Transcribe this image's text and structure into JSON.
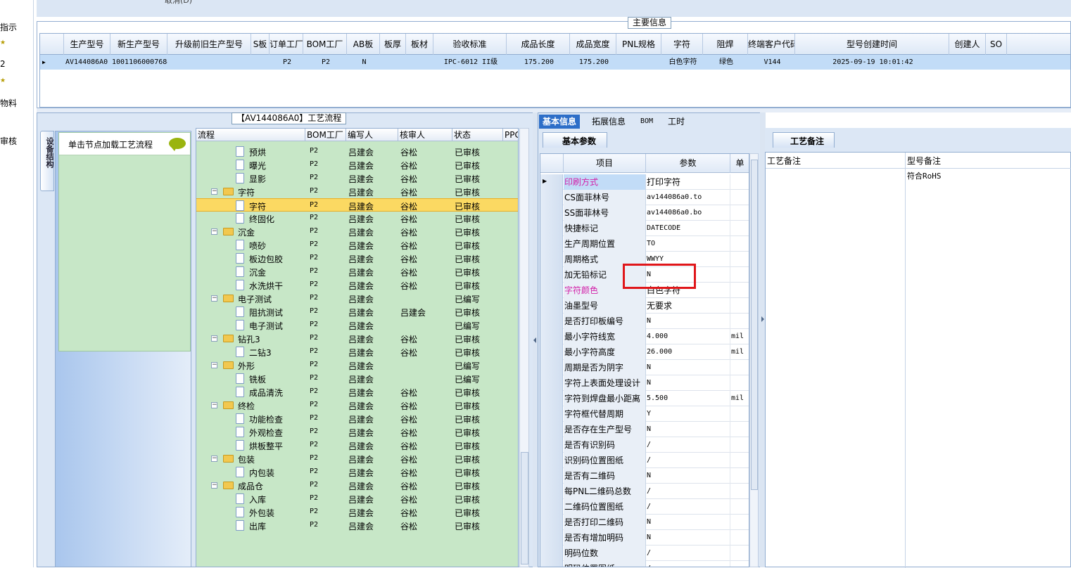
{
  "left_nav": {
    "items": [
      "指示",
      "2",
      "物料",
      "审核"
    ]
  },
  "top_strip": {
    "text": "取消(D)"
  },
  "main_info": {
    "legend": "主要信息",
    "columns": [
      "生产型号",
      "新生产型号",
      "升级前旧生产型号",
      "S板",
      "订单工厂",
      "BOM工厂",
      "AB板",
      "板厚",
      "板材",
      "验收标准",
      "成品长度",
      "成品宽度",
      "PNL规格",
      "字符",
      "阻焊",
      "终端客户代码",
      "型号创建时间",
      "创建人",
      "SO"
    ],
    "row": [
      "AV144086A0",
      "10011060007684",
      "",
      "",
      "P2",
      "P2",
      "N",
      "",
      "",
      "IPC-6012 II级",
      "175.200",
      "175.200",
      "",
      "白色字符",
      "绿色",
      "V144",
      "2025-09-19 10:01:42",
      "",
      ""
    ]
  },
  "process": {
    "legend": "【AV144086A0】工艺流程",
    "vertical_tab": "设备结构",
    "load_hint": "单击节点加载工艺流程",
    "columns": [
      "流程",
      "BOM工厂",
      "编写人",
      "核审人",
      "状态",
      "PPC"
    ],
    "rows": [
      {
        "type": "leaf",
        "name": "预烘",
        "bom": "P2",
        "writer": "吕建会",
        "reviewer": "谷松",
        "status": "已审核"
      },
      {
        "type": "leaf",
        "name": "曝光",
        "bom": "P2",
        "writer": "吕建会",
        "reviewer": "谷松",
        "status": "已审核"
      },
      {
        "type": "leaf",
        "name": "显影",
        "bom": "P2",
        "writer": "吕建会",
        "reviewer": "谷松",
        "status": "已审核"
      },
      {
        "type": "folder",
        "name": "字符",
        "bom": "P2",
        "writer": "吕建会",
        "reviewer": "谷松",
        "status": "已审核"
      },
      {
        "type": "leaf",
        "name": "字符",
        "bom": "P2",
        "writer": "吕建会",
        "reviewer": "谷松",
        "status": "已审核",
        "selected": true
      },
      {
        "type": "leaf",
        "name": "终固化",
        "bom": "P2",
        "writer": "吕建会",
        "reviewer": "谷松",
        "status": "已审核"
      },
      {
        "type": "folder",
        "name": "沉金",
        "bom": "P2",
        "writer": "吕建会",
        "reviewer": "谷松",
        "status": "已审核"
      },
      {
        "type": "leaf",
        "name": "喷砂",
        "bom": "P2",
        "writer": "吕建会",
        "reviewer": "谷松",
        "status": "已审核"
      },
      {
        "type": "leaf",
        "name": "板边包胶",
        "bom": "P2",
        "writer": "吕建会",
        "reviewer": "谷松",
        "status": "已审核"
      },
      {
        "type": "leaf",
        "name": "沉金",
        "bom": "P2",
        "writer": "吕建会",
        "reviewer": "谷松",
        "status": "已审核"
      },
      {
        "type": "leaf",
        "name": "水洗烘干",
        "bom": "P2",
        "writer": "吕建会",
        "reviewer": "谷松",
        "status": "已审核"
      },
      {
        "type": "folder",
        "name": "电子测试",
        "bom": "P2",
        "writer": "吕建会",
        "reviewer": "",
        "status": "已编写"
      },
      {
        "type": "leaf",
        "name": "阻抗测试",
        "bom": "P2",
        "writer": "吕建会",
        "reviewer": "吕建会",
        "status": "已审核"
      },
      {
        "type": "leaf",
        "name": "电子测试",
        "bom": "P2",
        "writer": "吕建会",
        "reviewer": "",
        "status": "已编写"
      },
      {
        "type": "folder",
        "name": "钻孔3",
        "bom": "P2",
        "writer": "吕建会",
        "reviewer": "谷松",
        "status": "已审核"
      },
      {
        "type": "leaf",
        "name": "二钻3",
        "bom": "P2",
        "writer": "吕建会",
        "reviewer": "谷松",
        "status": "已审核"
      },
      {
        "type": "folder",
        "name": "外形",
        "bom": "P2",
        "writer": "吕建会",
        "reviewer": "",
        "status": "已编写"
      },
      {
        "type": "leaf",
        "name": "铣板",
        "bom": "P2",
        "writer": "吕建会",
        "reviewer": "",
        "status": "已编写"
      },
      {
        "type": "leaf",
        "name": "成品清洗",
        "bom": "P2",
        "writer": "吕建会",
        "reviewer": "谷松",
        "status": "已审核"
      },
      {
        "type": "folder",
        "name": "终检",
        "bom": "P2",
        "writer": "吕建会",
        "reviewer": "谷松",
        "status": "已审核"
      },
      {
        "type": "leaf",
        "name": "功能检查",
        "bom": "P2",
        "writer": "吕建会",
        "reviewer": "谷松",
        "status": "已审核"
      },
      {
        "type": "leaf",
        "name": "外观检查",
        "bom": "P2",
        "writer": "吕建会",
        "reviewer": "谷松",
        "status": "已审核"
      },
      {
        "type": "leaf",
        "name": "烘板整平",
        "bom": "P2",
        "writer": "吕建会",
        "reviewer": "谷松",
        "status": "已审核"
      },
      {
        "type": "folder",
        "name": "包装",
        "bom": "P2",
        "writer": "吕建会",
        "reviewer": "谷松",
        "status": "已审核"
      },
      {
        "type": "leaf",
        "name": "内包装",
        "bom": "P2",
        "writer": "吕建会",
        "reviewer": "谷松",
        "status": "已审核"
      },
      {
        "type": "folder",
        "name": "成品仓",
        "bom": "P2",
        "writer": "吕建会",
        "reviewer": "谷松",
        "status": "已审核"
      },
      {
        "type": "leaf",
        "name": "入库",
        "bom": "P2",
        "writer": "吕建会",
        "reviewer": "谷松",
        "status": "已审核"
      },
      {
        "type": "leaf",
        "name": "外包装",
        "bom": "P2",
        "writer": "吕建会",
        "reviewer": "谷松",
        "status": "已审核"
      },
      {
        "type": "leaf",
        "name": "出库",
        "bom": "P2",
        "writer": "吕建会",
        "reviewer": "谷松",
        "status": "已审核"
      }
    ]
  },
  "tabs": [
    "基本信息",
    "拓展信息",
    "BOM",
    "工时"
  ],
  "basic": {
    "tab": "基本参数",
    "columns": [
      "项目",
      "参数",
      "单"
    ],
    "rows": [
      {
        "k": "印刷方式",
        "v": "打印字符",
        "u": "",
        "style": "mag",
        "hl": true,
        "current": true
      },
      {
        "k": "CS面菲林号",
        "v": "av144086a0.to",
        "u": "",
        "mono": true
      },
      {
        "k": "SS面菲林号",
        "v": "av144086a0.bo",
        "u": "",
        "mono": true
      },
      {
        "k": "快捷标记",
        "v": "DATECODE",
        "u": "",
        "mono": true
      },
      {
        "k": "生产周期位置",
        "v": "TO",
        "u": "",
        "mono": true
      },
      {
        "k": "周期格式",
        "v": "WWYY",
        "u": "",
        "mono": true
      },
      {
        "k": "加无铅标记",
        "v": "N",
        "u": "",
        "mono": true
      },
      {
        "k": "字符颜色",
        "v": "白色字符",
        "u": "",
        "style": "mag"
      },
      {
        "k": "油墨型号",
        "v": "无要求",
        "u": ""
      },
      {
        "k": "是否打印板编号",
        "v": "N",
        "u": "",
        "mono": true
      },
      {
        "k": "最小字符线宽",
        "v": "4.000",
        "u": "mil",
        "mono": true
      },
      {
        "k": "最小字符高度",
        "v": "26.000",
        "u": "mil",
        "mono": true
      },
      {
        "k": "周期是否为阴字",
        "v": "N",
        "u": "",
        "mono": true
      },
      {
        "k": "字符上表面处理设计",
        "v": "N",
        "u": "",
        "mono": true
      },
      {
        "k": "字符到焊盘最小距离",
        "v": "5.500",
        "u": "mil",
        "mono": true
      },
      {
        "k": "字符框代替周期",
        "v": "Y",
        "u": "",
        "mono": true
      },
      {
        "k": "是否存在生产型号",
        "v": "N",
        "u": "",
        "mono": true
      },
      {
        "k": "是否有识别码",
        "v": "/",
        "u": "",
        "mono": true
      },
      {
        "k": "识别码位置图纸",
        "v": "/",
        "u": "",
        "mono": true
      },
      {
        "k": "是否有二维码",
        "v": "N",
        "u": "",
        "mono": true
      },
      {
        "k": "每PNL二维码总数",
        "v": "/",
        "u": "",
        "mono": true
      },
      {
        "k": "二维码位置图纸",
        "v": "/",
        "u": "",
        "mono": true
      },
      {
        "k": "是否打印二维码",
        "v": "N",
        "u": "",
        "mono": true
      },
      {
        "k": "是否有增加明码",
        "v": "N",
        "u": "",
        "mono": true
      },
      {
        "k": "明码位数",
        "v": "/",
        "u": "",
        "mono": true
      },
      {
        "k": "明码位置图纸",
        "v": "/",
        "u": "",
        "mono": true
      }
    ]
  },
  "notes": {
    "tab": "工艺备注",
    "col1": "工艺备注",
    "col2": "型号备注",
    "value": "符合RoHS"
  }
}
